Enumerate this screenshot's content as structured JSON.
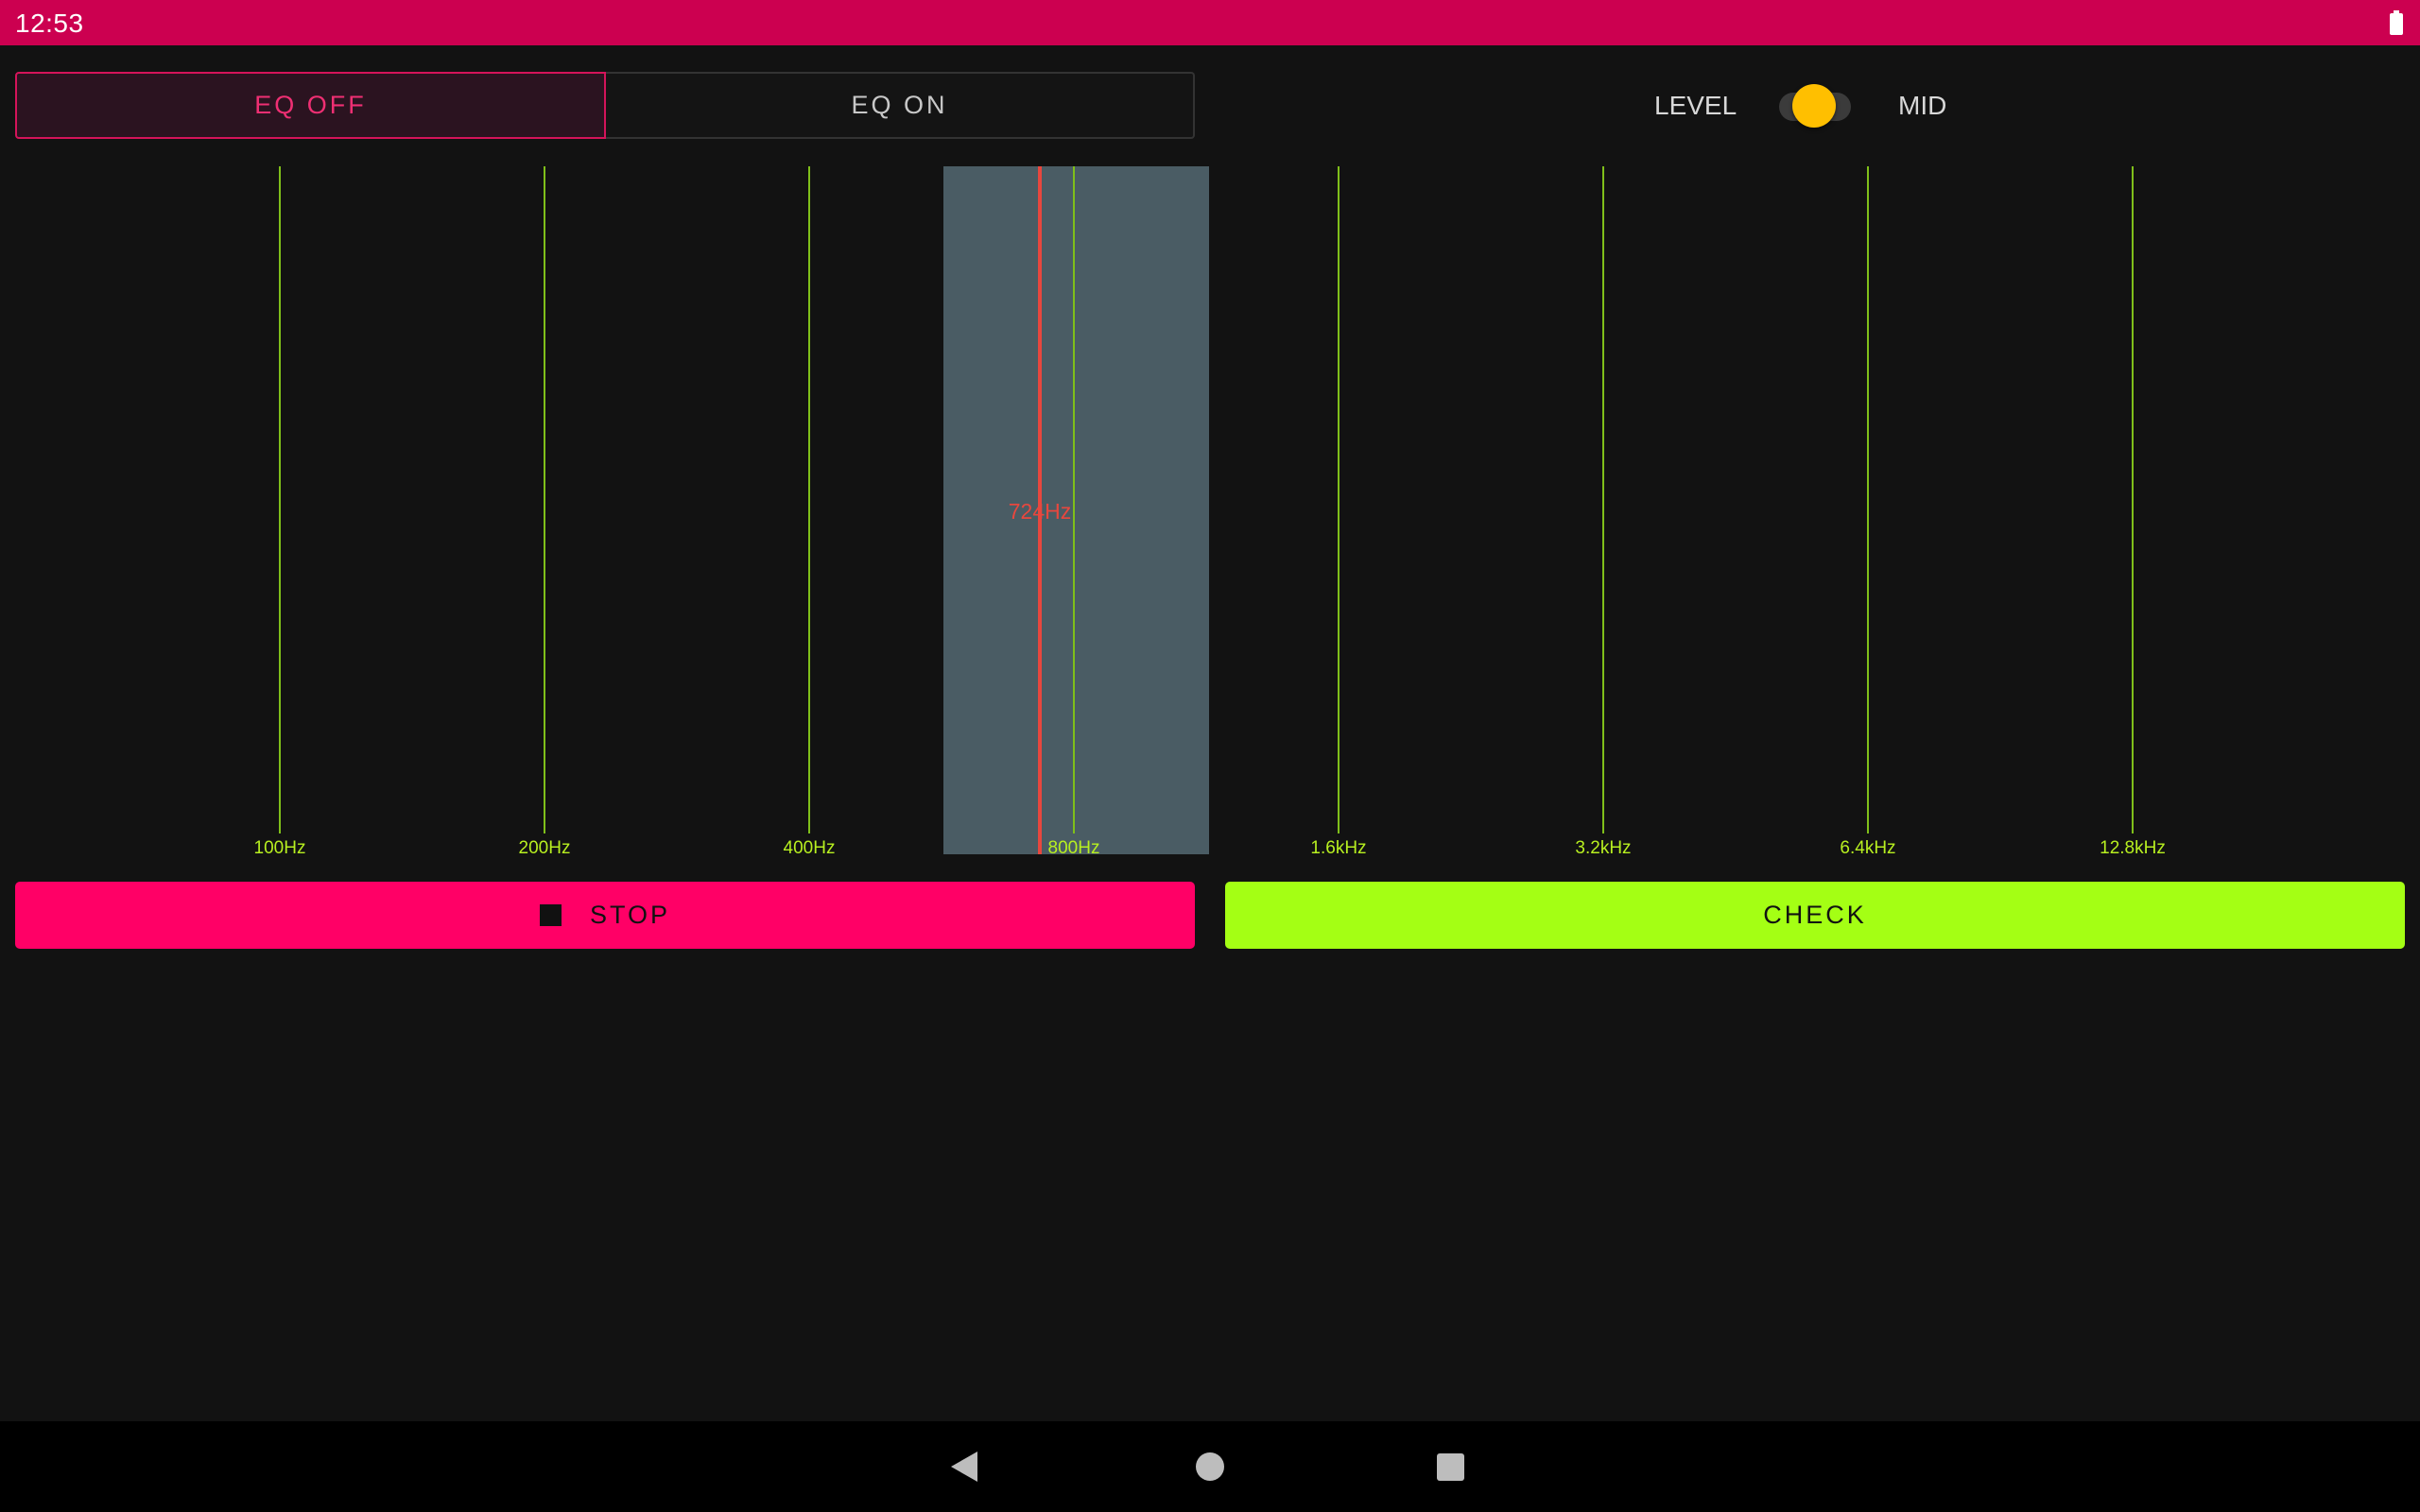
{
  "status_bar": {
    "time": "12:53",
    "icons": [
      "battery-icon"
    ]
  },
  "eq_toggle": {
    "options": [
      {
        "label": "EQ OFF",
        "selected": true
      },
      {
        "label": "EQ ON",
        "selected": false
      }
    ]
  },
  "level_switch": {
    "left_label": "LEVEL",
    "right_label": "MID",
    "state": "off"
  },
  "spectrum": {
    "bands": [
      "100Hz",
      "200Hz",
      "400Hz",
      "800Hz",
      "1.6kHz",
      "3.2kHz",
      "6.4kHz",
      "12.8kHz"
    ],
    "highlighted_band_index": 3,
    "marker_label": "724Hz"
  },
  "actions": {
    "stop_label": "STOP",
    "stop_icon": "stop-icon",
    "check_label": "CHECK"
  },
  "nav_bar": {
    "icons": [
      "back-icon",
      "home-icon",
      "recents-icon"
    ]
  },
  "colors": {
    "status_bar": "#cc0050",
    "accent_pink": "#ff0066",
    "accent_green": "#a4ff14",
    "band_line": "#7fbf1a",
    "band_label": "#b8f020",
    "marker": "#e8473e",
    "highlight": "#4a5c64",
    "switch_thumb": "#ffbf00",
    "background": "#121212"
  }
}
